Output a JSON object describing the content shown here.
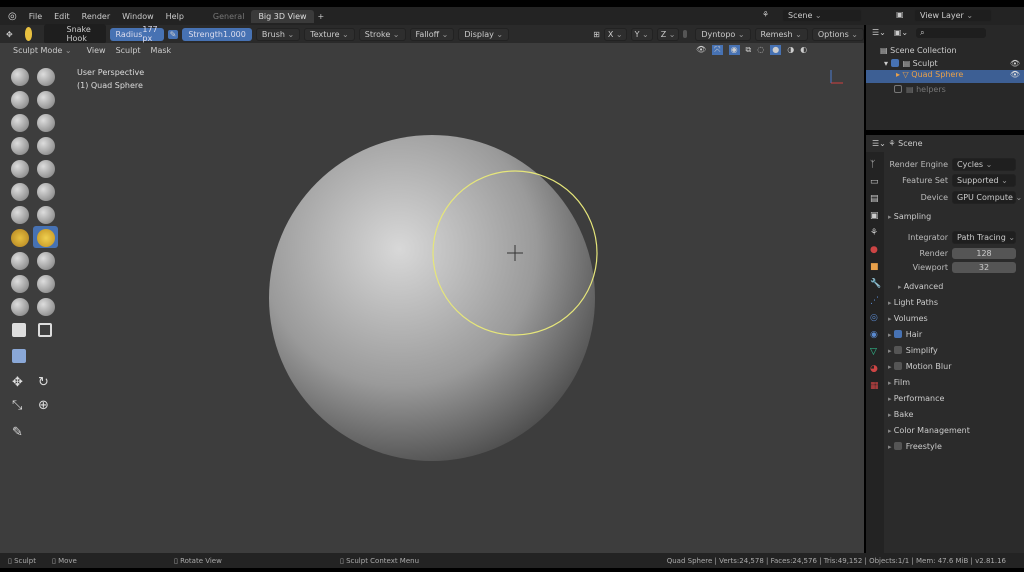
{
  "menu": [
    "File",
    "Edit",
    "Render",
    "Window",
    "Help"
  ],
  "workspace_tabs": [
    "General",
    "Big 3D View"
  ],
  "active_tab": "Big 3D View",
  "scene": "Scene",
  "view_layer": "View Layer",
  "tool_header": {
    "brush": "Snake Hook",
    "radius_label": "Radius",
    "radius_value": "177 px",
    "strength_label": "Strength",
    "strength_value": "1.000",
    "menus": [
      "Brush",
      "Texture",
      "Stroke",
      "Falloff",
      "Display"
    ],
    "axes": [
      "X",
      "Y",
      "Z"
    ],
    "right_menus": [
      "Dyntopo",
      "Remesh",
      "Options"
    ]
  },
  "viewport_header": {
    "mode": "Sculpt Mode",
    "menus": [
      "View",
      "Sculpt",
      "Mask"
    ]
  },
  "overlay": {
    "perspective": "User Perspective",
    "object": "(1) Quad Sphere"
  },
  "outliner": {
    "items": [
      "Scene Collection",
      "Sculpt",
      "Quad Sphere",
      "helpers"
    ]
  },
  "properties": {
    "context": "Scene",
    "render_engine_label": "Render Engine",
    "render_engine": "Cycles",
    "feature_set_label": "Feature Set",
    "feature_set": "Supported",
    "device_label": "Device",
    "device": "GPU Compute",
    "sampling": "Sampling",
    "integrator_label": "Integrator",
    "integrator": "Path Tracing",
    "render_label": "Render",
    "render": "128",
    "viewport_label": "Viewport",
    "viewport": "32",
    "advanced": "Advanced",
    "sections": [
      {
        "label": "Light Paths"
      },
      {
        "label": "Volumes"
      },
      {
        "label": "Hair",
        "check": true
      },
      {
        "label": "Simplify",
        "check": false
      },
      {
        "label": "Motion Blur",
        "check": false
      },
      {
        "label": "Film"
      },
      {
        "label": "Performance"
      },
      {
        "label": "Bake"
      },
      {
        "label": "Color Management"
      },
      {
        "label": "Freestyle",
        "check": false
      }
    ]
  },
  "status": {
    "left": [
      "Sculpt",
      "Move",
      "Rotate View",
      "Sculpt Context Menu"
    ],
    "right": "Quad Sphere | Verts:24,578 | Faces:24,576 | Tris:49,152 | Objects:1/1 | Mem: 47.6 MiB | v2.81.16"
  },
  "colors": {
    "accent": "#4772b3",
    "brush_circle": "#e6e67a",
    "selected_object": "#e8a04a"
  }
}
